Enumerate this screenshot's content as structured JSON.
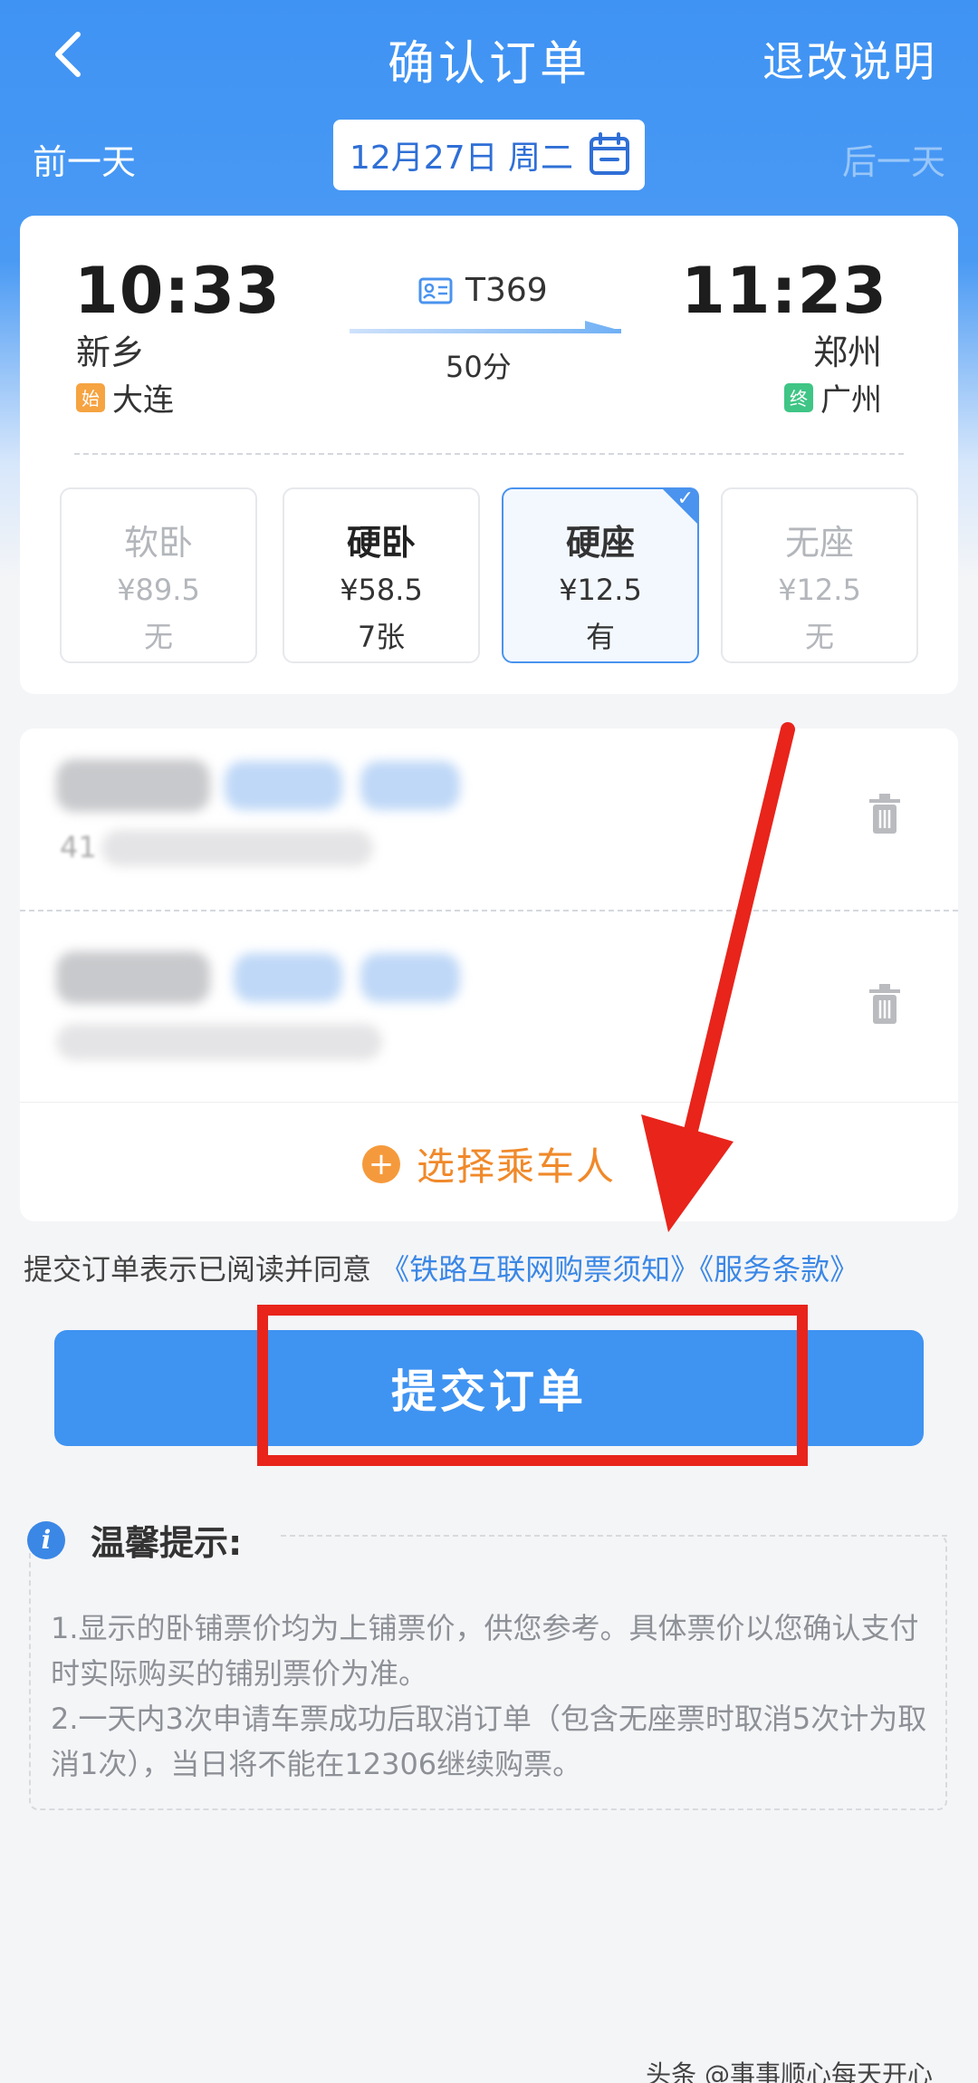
{
  "header": {
    "title": "确认订单",
    "refund_label": "退改说明"
  },
  "date_bar": {
    "prev_label": "前一天",
    "date": "12月27日 周二",
    "next_label": "后一天"
  },
  "train": {
    "number": "T369",
    "duration": "50分",
    "departure": {
      "time": "10:33",
      "station": "新乡",
      "origin_tag": "始",
      "origin": "大连"
    },
    "arrival": {
      "time": "11:23",
      "station": "郑州",
      "terminal_tag": "终",
      "terminal": "广州"
    }
  },
  "seats": [
    {
      "name": "软卧",
      "price": "¥89.5",
      "left": "无",
      "state": "unavailable"
    },
    {
      "name": "硬卧",
      "price": "¥58.5",
      "left": "7张",
      "state": "available"
    },
    {
      "name": "硬座",
      "price": "¥12.5",
      "left": "有",
      "state": "selected"
    },
    {
      "name": "无座",
      "price": "¥12.5",
      "left": "无",
      "state": "unavailable"
    }
  ],
  "passengers": {
    "add_label": "选择乘车人",
    "id_prefix": "41"
  },
  "agreement": {
    "prefix": "提交订单表示已阅读并同意",
    "link1": "《铁路互联网购票须知》",
    "link2": "《服务条款》"
  },
  "submit_label": "提交订单",
  "tips": {
    "title": "温馨提示:",
    "line1": "1.显示的卧铺票价均为上铺票价，供您参考。具体票价以您确认支付时实际购买的铺别票价为准。",
    "line2": "2.一天内3次申请车票成功后取消订单（包含无座票时取消5次计为取消1次），当日将不能在12306继续购票。"
  },
  "watermark": "头条 @事事顺心每天开心",
  "colors": {
    "primary": "#3f93f1",
    "accent_orange": "#f0892a",
    "annotation_red": "#e8241b"
  }
}
